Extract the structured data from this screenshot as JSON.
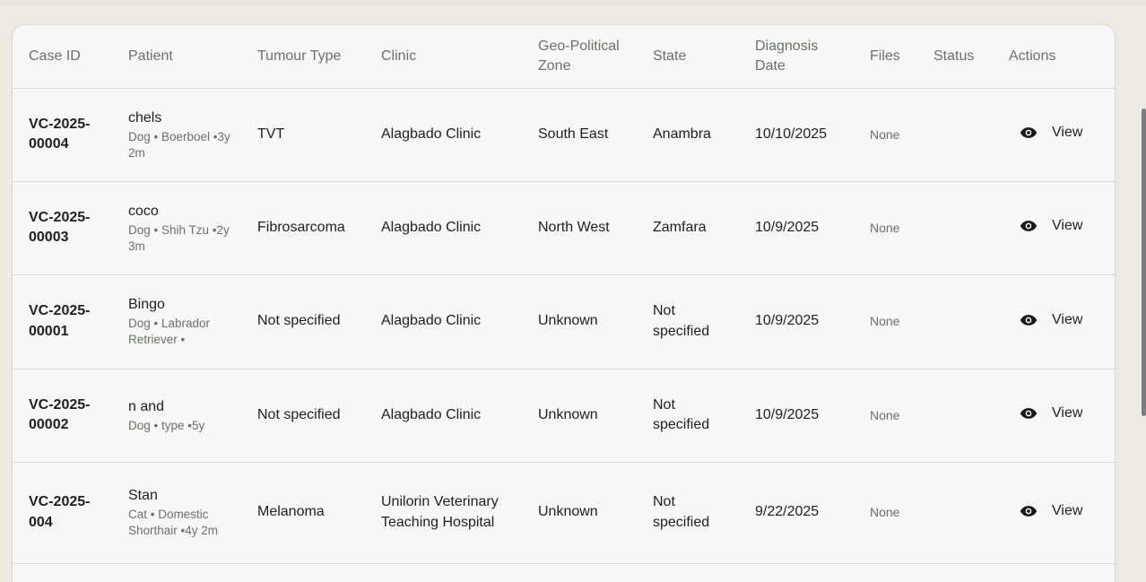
{
  "table": {
    "headers": {
      "case_id": "Case ID",
      "patient": "Patient",
      "tumour_type": "Tumour Type",
      "clinic": "Clinic",
      "zone": "Geo-Political Zone",
      "state": "State",
      "diagnosis_date": "Diagnosis Date",
      "files": "Files",
      "status": "Status",
      "actions": "Actions"
    },
    "rows": [
      {
        "case_id": "VC-2025-00004",
        "patient_name": "chels",
        "patient_meta": "Dog • Boerboel •3y 2m",
        "tumour_type": "TVT",
        "clinic": "Alagbado Clinic",
        "zone": "South East",
        "state": "Anambra",
        "diagnosis_date": "10/10/2025",
        "files": "None",
        "status": "",
        "action_label": "View"
      },
      {
        "case_id": "VC-2025-00003",
        "patient_name": "coco",
        "patient_meta": "Dog • Shih Tzu •2y 3m",
        "tumour_type": "Fibrosarcoma",
        "clinic": "Alagbado Clinic",
        "zone": "North West",
        "state": "Zamfara",
        "diagnosis_date": "10/9/2025",
        "files": "None",
        "status": "",
        "action_label": "View"
      },
      {
        "case_id": "VC-2025-00001",
        "patient_name": "Bingo",
        "patient_meta": "Dog • Labrador Retriever •",
        "tumour_type": "Not specified",
        "clinic": "Alagbado Clinic",
        "zone": "Unknown",
        "state": "Not specified",
        "diagnosis_date": "10/9/2025",
        "files": "None",
        "status": "",
        "action_label": "View"
      },
      {
        "case_id": "VC-2025-00002",
        "patient_name": "n and",
        "patient_meta": "Dog • type •5y",
        "tumour_type": "Not specified",
        "clinic": "Alagbado Clinic",
        "zone": "Unknown",
        "state": "Not specified",
        "diagnosis_date": "10/9/2025",
        "files": "None",
        "status": "",
        "action_label": "View"
      },
      {
        "case_id": "VC-2025-004",
        "patient_name": "Stan",
        "patient_meta": "Cat • Domestic Shorthair •4y 2m",
        "tumour_type": "Melanoma",
        "clinic": "Unilorin Veterinary Teaching Hospital",
        "zone": "Unknown",
        "state": "Not specified",
        "diagnosis_date": "9/22/2025",
        "files": "None",
        "status": "",
        "action_label": "View"
      }
    ]
  },
  "icons": {
    "action": "eye-icon"
  }
}
